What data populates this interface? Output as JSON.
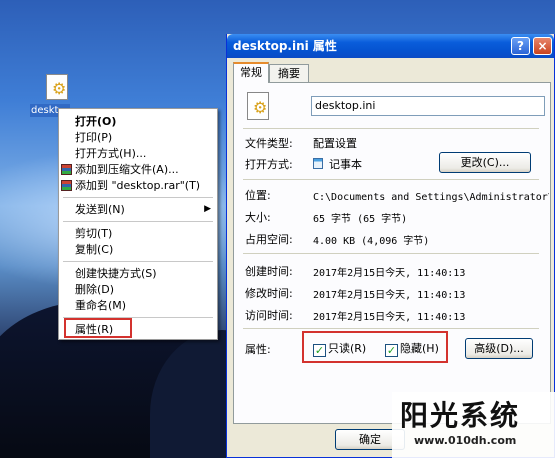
{
  "desktop": {
    "icon_label": "deskt",
    "icon": "settings-file-icon"
  },
  "context_menu": {
    "items": [
      {
        "label": "打开(O)",
        "bold": true
      },
      {
        "label": "打印(P)"
      },
      {
        "label": "打开方式(H)..."
      },
      {
        "label": "添加到压缩文件(A)..."
      },
      {
        "label": "添加到 \"desktop.rar\"(T)"
      },
      {
        "label": "发送到(N)",
        "submenu": true
      },
      {
        "label": "剪切(T)"
      },
      {
        "label": "复制(C)"
      },
      {
        "label": "创建快捷方式(S)"
      },
      {
        "label": "删除(D)"
      },
      {
        "label": "重命名(M)"
      },
      {
        "label": "属性(R)",
        "highlighted": true
      }
    ],
    "submenu_arrow": "▶"
  },
  "window": {
    "title": "desktop.ini 属性",
    "help_button": "?",
    "close_button": "×",
    "tabs": [
      {
        "label": "常规",
        "active": true
      },
      {
        "label": "摘要",
        "active": false
      }
    ],
    "filename": "desktop.ini",
    "file_type_label": "文件类型:",
    "file_type_value": "配置设置",
    "opens_with_label": "打开方式:",
    "opens_with_value": "记事本",
    "change_button": "更改(C)...",
    "location_label": "位置:",
    "location_value": "C:\\Documents and Settings\\Administrator\\桌面",
    "size_label": "大小:",
    "size_value": "65 字节 (65 字节)",
    "size_on_disk_label": "占用空间:",
    "size_on_disk_value": "4.00 KB (4,096 字节)",
    "created_label": "创建时间:",
    "created_value": "2017年2月15日今天, 11:40:13",
    "modified_label": "修改时间:",
    "modified_value": "2017年2月15日今天, 11:40:13",
    "accessed_label": "访问时间:",
    "accessed_value": "2017年2月15日今天, 11:40:13",
    "attributes_label": "属性:",
    "readonly_label": "只读(R)",
    "readonly_checked": true,
    "hidden_label": "隐藏(H)",
    "hidden_checked": true,
    "advanced_button": "高级(D)...",
    "ok_button": "确定",
    "check_glyph": "✓"
  },
  "watermark": {
    "title": "阳光系统",
    "url": "www.010dh.com"
  },
  "colors": {
    "highlight_box": "#d3322e",
    "titlebar": "#0553d0",
    "selection": "#316ac5"
  }
}
